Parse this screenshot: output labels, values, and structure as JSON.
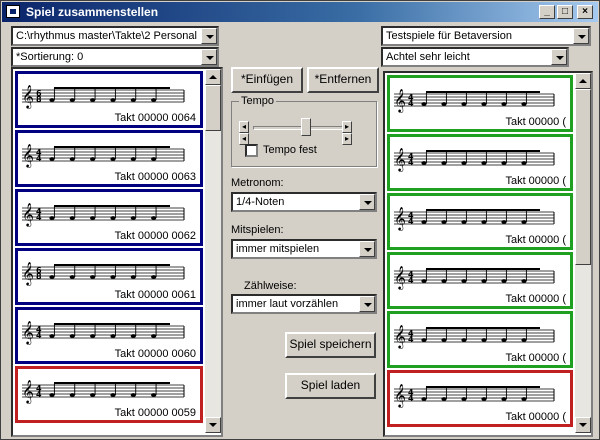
{
  "window": {
    "title": "Spiel zusammenstellen"
  },
  "titlebar_buttons": {
    "minimize": "_",
    "maximize": "□",
    "close": "×"
  },
  "left": {
    "path_value": "C:\\rhythmus master\\Takte\\2 Personal",
    "sort_value": "*Sortierung: 0",
    "measures": [
      {
        "label": "Takt 00000 0064",
        "meter": [
          "6",
          "8"
        ],
        "border": "blue"
      },
      {
        "label": "Takt 00000 0063",
        "meter": [
          "4",
          "4"
        ],
        "border": "blue"
      },
      {
        "label": "Takt 00000 0062",
        "meter": [
          "4",
          "4"
        ],
        "border": "blue"
      },
      {
        "label": "Takt 00000 0061",
        "meter": [
          "6",
          "8"
        ],
        "border": "blue"
      },
      {
        "label": "Takt 00000 0060",
        "meter": [
          "4",
          "4"
        ],
        "border": "blue"
      },
      {
        "label": "Takt 00000 0059",
        "meter": [
          "4",
          "4"
        ],
        "border": "red"
      }
    ]
  },
  "right": {
    "game_value": "Testspiele für Betaversion",
    "level_value": "Achtel sehr leicht",
    "measures": [
      {
        "label": "Takt 00000 (",
        "meter": [
          "4",
          "4"
        ],
        "border": "green"
      },
      {
        "label": "Takt 00000 (",
        "meter": [
          "4",
          "4"
        ],
        "border": "green"
      },
      {
        "label": "Takt 00000 (",
        "meter": [
          "4",
          "4"
        ],
        "border": "green"
      },
      {
        "label": "Takt 00000 (",
        "meter": [
          "4",
          "4"
        ],
        "border": "green"
      },
      {
        "label": "Takt 00000 (",
        "meter": [
          "4",
          "4"
        ],
        "border": "green"
      },
      {
        "label": "Takt 00000 (",
        "meter": [
          "4",
          "4"
        ],
        "border": "red"
      }
    ]
  },
  "center": {
    "insert_label": "*Einfügen",
    "remove_label": "*Entfernen",
    "tempo_group_label": "Tempo",
    "tempo_fixed_label": "Tempo fest",
    "metronome_label": "Metronom:",
    "metronome_value": "1/4-Noten",
    "play_along_label": "Mitspielen:",
    "play_along_value": "immer mitspielen",
    "count_label": "Zählweise:",
    "count_value": "immer laut vorzählen",
    "save_label": "Spiel speichern",
    "load_label": "Spiel laden"
  },
  "colors": {
    "blue": "#000080",
    "red": "#c02020",
    "green": "#20a020"
  }
}
